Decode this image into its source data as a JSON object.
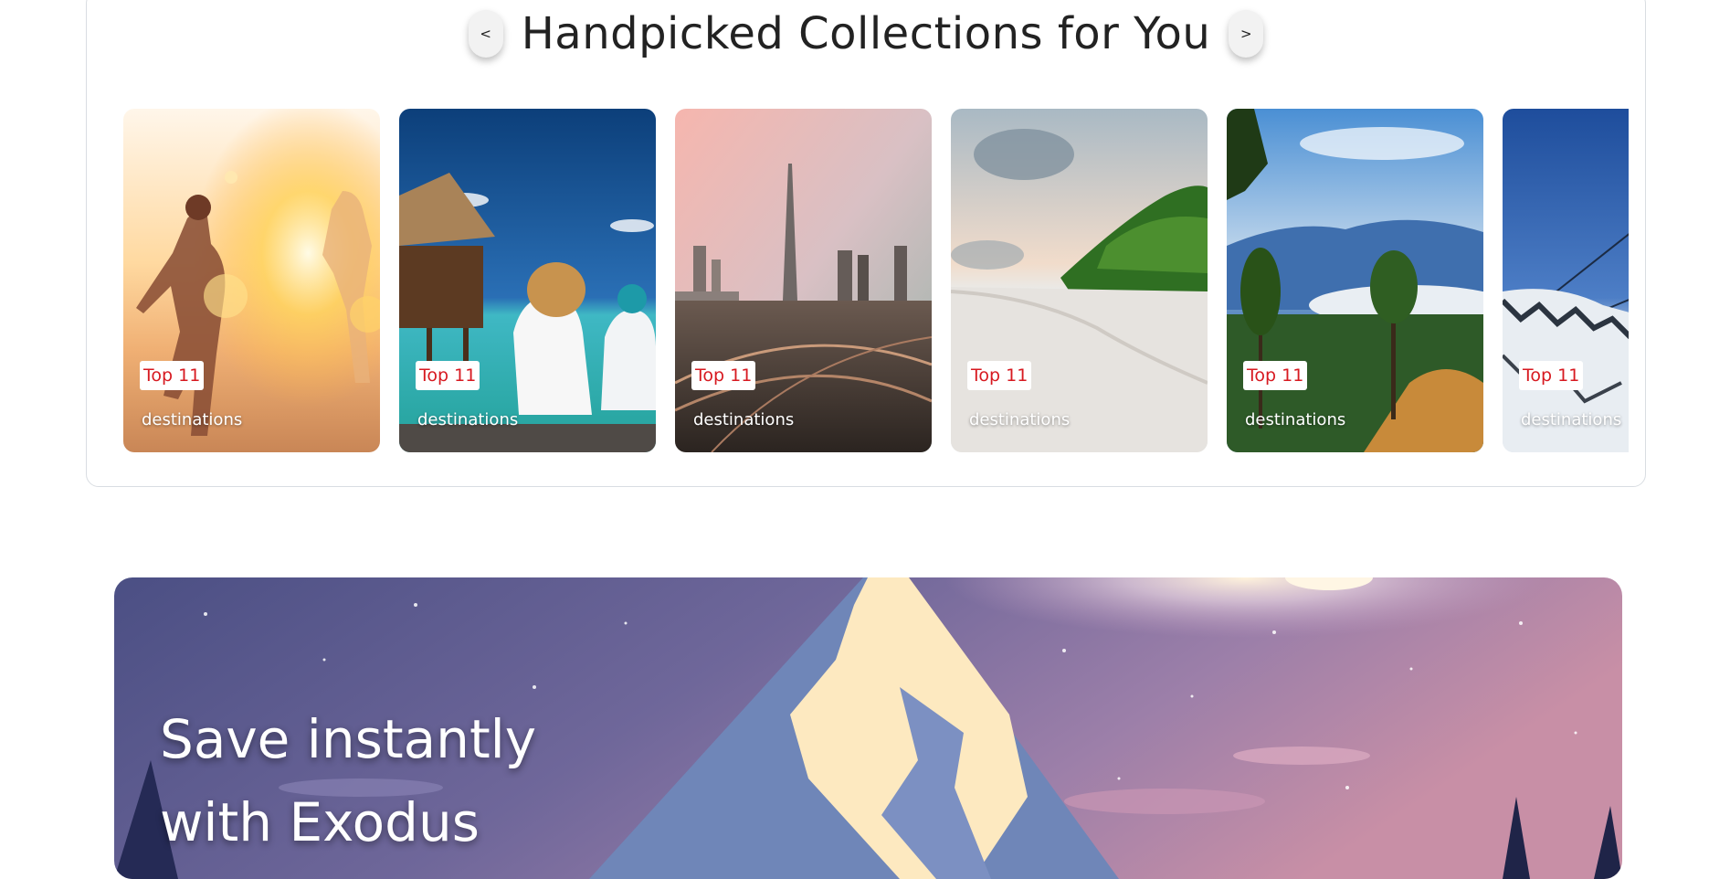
{
  "collections": {
    "title": "Handpicked Collections for You",
    "prev_label": "<",
    "next_label": ">",
    "cards": [
      {
        "badge": "Top 11",
        "caption": "destinations",
        "scene": "couple-sunset-beach"
      },
      {
        "badge": "Top 11",
        "caption": "destinations",
        "scene": "maldives-water-villa"
      },
      {
        "badge": "Top 11",
        "caption": "destinations",
        "scene": "dubai-skyline"
      },
      {
        "badge": "Top 11",
        "caption": "destinations",
        "scene": "tropical-beach"
      },
      {
        "badge": "Top 11",
        "caption": "destinations",
        "scene": "mountain-pine-valley"
      },
      {
        "badge": "Top 11",
        "caption": "destinations",
        "scene": "snowy-ski-slope"
      }
    ]
  },
  "promo": {
    "line1": "Save instantly",
    "line2": "with Exodus"
  },
  "colors": {
    "badge_text": "#d71920",
    "card_border": "#d9dde2",
    "heading_text": "#222222"
  }
}
